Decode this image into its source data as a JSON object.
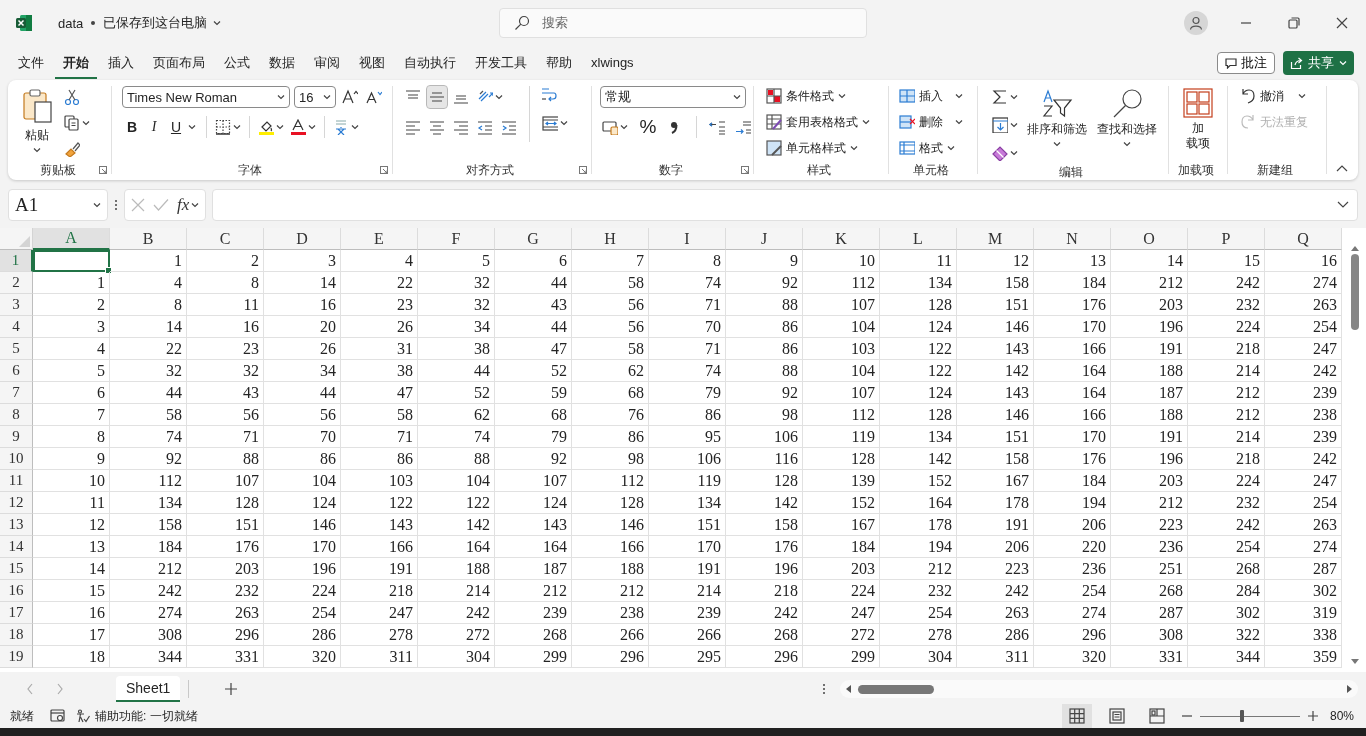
{
  "title_bar": {
    "file_name": "data",
    "save_status": "已保存到这台电脑",
    "search_placeholder": "搜索"
  },
  "menu_tabs": [
    {
      "label": "文件",
      "selected": false
    },
    {
      "label": "开始",
      "selected": true
    },
    {
      "label": "插入",
      "selected": false
    },
    {
      "label": "页面布局",
      "selected": false
    },
    {
      "label": "公式",
      "selected": false
    },
    {
      "label": "数据",
      "selected": false
    },
    {
      "label": "审阅",
      "selected": false
    },
    {
      "label": "视图",
      "selected": false
    },
    {
      "label": "自动执行",
      "selected": false
    },
    {
      "label": "开发工具",
      "selected": false
    },
    {
      "label": "帮助",
      "selected": false
    },
    {
      "label": "xlwings",
      "selected": false
    }
  ],
  "header_buttons": {
    "comments": "批注",
    "share": "共享"
  },
  "ribbon": {
    "groups": [
      {
        "kind": "clipboard",
        "label": "剪贴板",
        "paste": "粘贴"
      },
      {
        "kind": "font",
        "label": "字体",
        "font_name": "Times New Roman",
        "font_size": "16",
        "style_buttons": [
          "B",
          "I",
          "U"
        ]
      },
      {
        "kind": "alignment",
        "label": "对齐方式"
      },
      {
        "kind": "number",
        "label": "数字",
        "format": "常规",
        "percent": "%"
      },
      {
        "kind": "styles",
        "label": "样式",
        "buttons": [
          "条件格式",
          "套用表格格式",
          "单元格样式"
        ]
      },
      {
        "kind": "cells",
        "label": "单元格",
        "buttons": [
          "插入",
          "删除",
          "格式"
        ]
      },
      {
        "kind": "editing",
        "label": "编辑",
        "buttons": [
          "排序和筛选",
          "查找和选择"
        ]
      },
      {
        "kind": "addins",
        "label": "加载项",
        "button_lines": [
          "加",
          "载项"
        ]
      },
      {
        "kind": "undo",
        "label": "新建组",
        "undo": "撤消",
        "redo": "无法重复",
        "redo_disabled": true
      }
    ]
  },
  "formula_bar": {
    "name_box": "A1",
    "function_label": "fx"
  },
  "sheet": {
    "columns": [
      {
        "label": "A",
        "selected": true
      },
      {
        "label": "B",
        "selected": false
      },
      {
        "label": "C",
        "selected": false
      },
      {
        "label": "D",
        "selected": false
      },
      {
        "label": "E",
        "selected": false
      },
      {
        "label": "F",
        "selected": false
      },
      {
        "label": "G",
        "selected": false
      },
      {
        "label": "H",
        "selected": false
      },
      {
        "label": "I",
        "selected": false
      },
      {
        "label": "J",
        "selected": false
      },
      {
        "label": "K",
        "selected": false
      },
      {
        "label": "L",
        "selected": false
      },
      {
        "label": "M",
        "selected": false
      },
      {
        "label": "N",
        "selected": false
      },
      {
        "label": "O",
        "selected": false
      },
      {
        "label": "P",
        "selected": false
      },
      {
        "label": "Q",
        "selected": false
      }
    ],
    "rows": [
      {
        "header": "1",
        "selected": true,
        "cells": [
          null,
          "1",
          "2",
          "3",
          "4",
          "5",
          "6",
          "7",
          "8",
          "9",
          "10",
          "11",
          "12",
          "13",
          "14",
          "15",
          "16"
        ]
      },
      {
        "header": "2",
        "selected": false,
        "cells": [
          "1",
          "4",
          "8",
          "14",
          "22",
          "32",
          "44",
          "58",
          "74",
          "92",
          "112",
          "134",
          "158",
          "184",
          "212",
          "242",
          "274"
        ]
      },
      {
        "header": "3",
        "selected": false,
        "cells": [
          "2",
          "8",
          "11",
          "16",
          "23",
          "32",
          "43",
          "56",
          "71",
          "88",
          "107",
          "128",
          "151",
          "176",
          "203",
          "232",
          "263"
        ]
      },
      {
        "header": "4",
        "selected": false,
        "cells": [
          "3",
          "14",
          "16",
          "20",
          "26",
          "34",
          "44",
          "56",
          "70",
          "86",
          "104",
          "124",
          "146",
          "170",
          "196",
          "224",
          "254"
        ]
      },
      {
        "header": "5",
        "selected": false,
        "cells": [
          "4",
          "22",
          "23",
          "26",
          "31",
          "38",
          "47",
          "58",
          "71",
          "86",
          "103",
          "122",
          "143",
          "166",
          "191",
          "218",
          "247"
        ]
      },
      {
        "header": "6",
        "selected": false,
        "cells": [
          "5",
          "32",
          "32",
          "34",
          "38",
          "44",
          "52",
          "62",
          "74",
          "88",
          "104",
          "122",
          "142",
          "164",
          "188",
          "214",
          "242"
        ]
      },
      {
        "header": "7",
        "selected": false,
        "cells": [
          "6",
          "44",
          "43",
          "44",
          "47",
          "52",
          "59",
          "68",
          "79",
          "92",
          "107",
          "124",
          "143",
          "164",
          "187",
          "212",
          "239"
        ]
      },
      {
        "header": "8",
        "selected": false,
        "cells": [
          "7",
          "58",
          "56",
          "56",
          "58",
          "62",
          "68",
          "76",
          "86",
          "98",
          "112",
          "128",
          "146",
          "166",
          "188",
          "212",
          "238"
        ]
      },
      {
        "header": "9",
        "selected": false,
        "cells": [
          "8",
          "74",
          "71",
          "70",
          "71",
          "74",
          "79",
          "86",
          "95",
          "106",
          "119",
          "134",
          "151",
          "170",
          "191",
          "214",
          "239"
        ]
      },
      {
        "header": "10",
        "selected": false,
        "cells": [
          "9",
          "92",
          "88",
          "86",
          "86",
          "88",
          "92",
          "98",
          "106",
          "116",
          "128",
          "142",
          "158",
          "176",
          "196",
          "218",
          "242"
        ]
      },
      {
        "header": "11",
        "selected": false,
        "cells": [
          "10",
          "112",
          "107",
          "104",
          "103",
          "104",
          "107",
          "112",
          "119",
          "128",
          "139",
          "152",
          "167",
          "184",
          "203",
          "224",
          "247"
        ]
      },
      {
        "header": "12",
        "selected": false,
        "cells": [
          "11",
          "134",
          "128",
          "124",
          "122",
          "122",
          "124",
          "128",
          "134",
          "142",
          "152",
          "164",
          "178",
          "194",
          "212",
          "232",
          "254"
        ]
      },
      {
        "header": "13",
        "selected": false,
        "cells": [
          "12",
          "158",
          "151",
          "146",
          "143",
          "142",
          "143",
          "146",
          "151",
          "158",
          "167",
          "178",
          "191",
          "206",
          "223",
          "242",
          "263"
        ]
      },
      {
        "header": "14",
        "selected": false,
        "cells": [
          "13",
          "184",
          "176",
          "170",
          "166",
          "164",
          "164",
          "166",
          "170",
          "176",
          "184",
          "194",
          "206",
          "220",
          "236",
          "254",
          "274"
        ]
      },
      {
        "header": "15",
        "selected": false,
        "cells": [
          "14",
          "212",
          "203",
          "196",
          "191",
          "188",
          "187",
          "188",
          "191",
          "196",
          "203",
          "212",
          "223",
          "236",
          "251",
          "268",
          "287"
        ]
      },
      {
        "header": "16",
        "selected": false,
        "cells": [
          "15",
          "242",
          "232",
          "224",
          "218",
          "214",
          "212",
          "212",
          "214",
          "218",
          "224",
          "232",
          "242",
          "254",
          "268",
          "284",
          "302"
        ]
      },
      {
        "header": "17",
        "selected": false,
        "cells": [
          "16",
          "274",
          "263",
          "254",
          "247",
          "242",
          "239",
          "238",
          "239",
          "242",
          "247",
          "254",
          "263",
          "274",
          "287",
          "302",
          "319"
        ]
      },
      {
        "header": "18",
        "selected": false,
        "cells": [
          "17",
          "308",
          "296",
          "286",
          "278",
          "272",
          "268",
          "266",
          "266",
          "268",
          "272",
          "278",
          "286",
          "296",
          "308",
          "322",
          "338"
        ]
      },
      {
        "header": "19",
        "selected": false,
        "cells": [
          "18",
          "344",
          "331",
          "320",
          "311",
          "304",
          "299",
          "296",
          "295",
          "296",
          "299",
          "304",
          "311",
          "320",
          "331",
          "344",
          "359"
        ]
      }
    ]
  },
  "sheet_tabs": [
    {
      "label": "Sheet1",
      "selected": true
    }
  ],
  "status_bar": {
    "ready": "就绪",
    "accessibility": "辅助功能: 一切就绪",
    "view_modes": [
      {
        "selected": true
      },
      {
        "selected": false
      },
      {
        "selected": false
      }
    ],
    "zoom_slider": {
      "level": 0.42
    },
    "zoom": "80%"
  }
}
